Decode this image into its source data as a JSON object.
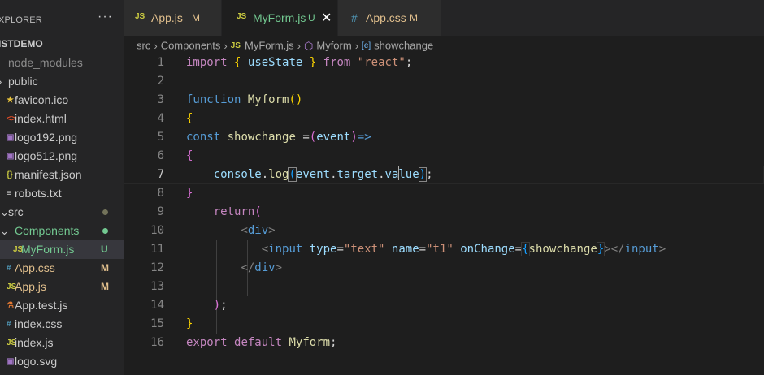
{
  "explorer": {
    "title": "XPLORER",
    "more": "···",
    "project": "ISTDEMO",
    "items": [
      {
        "label": "node_modules",
        "icon": "",
        "dim": true
      },
      {
        "label": "public",
        "icon": ""
      },
      {
        "label": "favicon.ico",
        "icon": "★",
        "iconColor": "#e8c23a"
      },
      {
        "label": "index.html",
        "icon": "<>",
        "iconColor": "#e44d26"
      },
      {
        "label": "logo192.png",
        "icon": "▣",
        "iconColor": "#a074c4"
      },
      {
        "label": "logo512.png",
        "icon": "▣",
        "iconColor": "#a074c4"
      },
      {
        "label": "manifest.json",
        "icon": "{}",
        "iconColor": "#cbcb41"
      },
      {
        "label": "robots.txt",
        "icon": "≡",
        "iconColor": "#cccccc"
      },
      {
        "label": "src",
        "icon": "",
        "dot": "#73735a"
      },
      {
        "label": "Components",
        "icon": "",
        "color": "#73c991",
        "dot": "#73c991"
      },
      {
        "label": "MyForm.js",
        "icon": "JS",
        "iconColor": "#cbcb41",
        "color": "#73c991",
        "badge": "U",
        "badgeColor": "#73c991"
      },
      {
        "label": "App.css",
        "icon": "#",
        "iconColor": "#519aba",
        "color": "#e2c08d",
        "badge": "M",
        "badgeColor": "#e2c08d"
      },
      {
        "label": "App.js",
        "icon": "JS",
        "iconColor": "#cbcb41",
        "color": "#e2c08d",
        "badge": "M",
        "badgeColor": "#e2c08d"
      },
      {
        "label": "App.test.js",
        "icon": "⚗",
        "iconColor": "#e37933"
      },
      {
        "label": "index.css",
        "icon": "#",
        "iconColor": "#519aba"
      },
      {
        "label": "index.js",
        "icon": "JS",
        "iconColor": "#cbcb41"
      },
      {
        "label": "logo.svg",
        "icon": "▣",
        "iconColor": "#a074c4"
      }
    ]
  },
  "tabs": [
    {
      "icon": "JS",
      "label": "App.js",
      "badge": "M",
      "color": "#e2c08d",
      "badgeColor": "#e2c08d"
    },
    {
      "icon": "JS",
      "label": "MyForm.js",
      "badge": "U",
      "color": "#73c991",
      "badgeColor": "#73c991",
      "close": "✕"
    },
    {
      "icon": "#",
      "label": "App.css",
      "badge": "M",
      "color": "#e2c08d",
      "badgeColor": "#e2c08d"
    }
  ],
  "breadcrumb": {
    "src": "src",
    "components": "Components",
    "file_icon": "JS",
    "file": "MyForm.js",
    "symbol_icon": "⬡",
    "symbol": "Myform",
    "member_icon": "[e]",
    "member": "showchange"
  },
  "editor": {
    "current_line": 7,
    "lines": [
      {
        "n": "1",
        "tokens": [
          [
            "kw2",
            "import"
          ],
          [
            "pl",
            " "
          ],
          [
            "br1",
            "{"
          ],
          [
            "pl",
            " "
          ],
          [
            "id",
            "useState"
          ],
          [
            "pl",
            " "
          ],
          [
            "br1",
            "}"
          ],
          [
            "pl",
            " "
          ],
          [
            "kw2",
            "from"
          ],
          [
            "pl",
            " "
          ],
          [
            "str",
            "\"react\""
          ],
          [
            "pl",
            ";"
          ]
        ]
      },
      {
        "n": "2",
        "tokens": []
      },
      {
        "n": "3",
        "tokens": [
          [
            "kw",
            "function"
          ],
          [
            "pl",
            " "
          ],
          [
            "fn",
            "Myform"
          ],
          [
            "br1",
            "()"
          ]
        ]
      },
      {
        "n": "4",
        "tokens": [
          [
            "br1",
            "{"
          ]
        ]
      },
      {
        "n": "5",
        "tokens": [
          [
            "kw",
            "const"
          ],
          [
            "pl",
            " "
          ],
          [
            "fn",
            "showchange"
          ],
          [
            "pl",
            " ="
          ],
          [
            "br2",
            "("
          ],
          [
            "id",
            "event"
          ],
          [
            "br2",
            ")"
          ],
          [
            "kw",
            "=>"
          ]
        ]
      },
      {
        "n": "6",
        "tokens": [
          [
            "br2",
            "{"
          ]
        ]
      },
      {
        "n": "7",
        "tokens": [
          [
            "pl",
            "    "
          ],
          [
            "id",
            "console"
          ],
          [
            "pl",
            "."
          ],
          [
            "fn",
            "log"
          ],
          [
            "br3m",
            "("
          ],
          [
            "id",
            "event"
          ],
          [
            "pl",
            "."
          ],
          [
            "id",
            "target"
          ],
          [
            "pl",
            "."
          ],
          [
            "id",
            "va"
          ],
          [
            "cursor",
            ""
          ],
          [
            "id",
            "lue"
          ],
          [
            "br3m",
            ")"
          ],
          [
            "pl",
            ";"
          ]
        ]
      },
      {
        "n": "8",
        "tokens": [
          [
            "br2",
            "}"
          ]
        ]
      },
      {
        "n": "9",
        "tokens": [
          [
            "pl",
            "    "
          ],
          [
            "kw2",
            "return"
          ],
          [
            "br2",
            "("
          ]
        ]
      },
      {
        "n": "10",
        "tokens": [
          [
            "pl",
            "        "
          ],
          [
            "tag",
            "<"
          ],
          [
            "tagn",
            "div"
          ],
          [
            "tag",
            ">"
          ]
        ]
      },
      {
        "n": "11",
        "tokens": [
          [
            "pl",
            "           "
          ],
          [
            "tag",
            "<"
          ],
          [
            "tagn",
            "input"
          ],
          [
            "pl",
            " "
          ],
          [
            "attr",
            "type"
          ],
          [
            "pl",
            "="
          ],
          [
            "str",
            "\"text\""
          ],
          [
            "pl",
            " "
          ],
          [
            "attr",
            "name"
          ],
          [
            "pl",
            "="
          ],
          [
            "str",
            "\"t1\""
          ],
          [
            "pl",
            " "
          ],
          [
            "attr",
            "onChange"
          ],
          [
            "pl",
            "="
          ],
          [
            "br3b",
            "{"
          ],
          [
            "fn",
            "showchange"
          ],
          [
            "br3b",
            "}"
          ],
          [
            "tag",
            "></"
          ],
          [
            "tagn",
            "input"
          ],
          [
            "tag",
            ">"
          ]
        ]
      },
      {
        "n": "12",
        "tokens": [
          [
            "pl",
            "        "
          ],
          [
            "tag",
            "</"
          ],
          [
            "tagn",
            "div"
          ],
          [
            "tag",
            ">"
          ]
        ]
      },
      {
        "n": "13",
        "tokens": []
      },
      {
        "n": "14",
        "tokens": [
          [
            "pl",
            "    "
          ],
          [
            "br2",
            ")"
          ],
          [
            "pl",
            ";"
          ]
        ]
      },
      {
        "n": "15",
        "tokens": [
          [
            "br1",
            "}"
          ]
        ]
      },
      {
        "n": "16",
        "tokens": [
          [
            "kw2",
            "export"
          ],
          [
            "pl",
            " "
          ],
          [
            "kw2",
            "default"
          ],
          [
            "pl",
            " "
          ],
          [
            "fn",
            "Myform"
          ],
          [
            "pl",
            ";"
          ]
        ]
      }
    ]
  }
}
